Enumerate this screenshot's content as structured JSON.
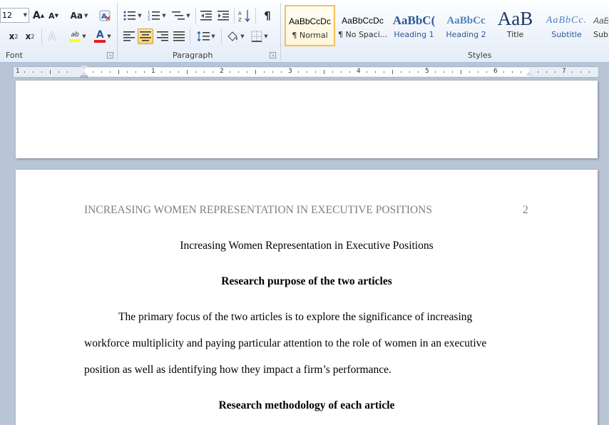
{
  "ribbon": {
    "font_group": {
      "label": "Font",
      "font_size": "12",
      "grow_label": "A",
      "shrink_label": "A",
      "case_label": "Aa",
      "clear_label": "A",
      "subscript_label": "x",
      "superscript_label": "x",
      "text_effects_label": "A",
      "highlight_label": "ab",
      "font_color_label": "A"
    },
    "paragraph_group": {
      "label": "Paragraph",
      "pilcrow": "¶"
    },
    "styles_group": {
      "label": "Styles",
      "tiles": [
        {
          "sample": "AaBbCcDc",
          "name": "¶ Normal"
        },
        {
          "sample": "AaBbCcDc",
          "name": "¶ No Spaci..."
        },
        {
          "sample": "AaBbC(",
          "name": "Heading 1"
        },
        {
          "sample": "AaBbCc",
          "name": "Heading 2"
        },
        {
          "sample": "AaB",
          "name": "Title"
        },
        {
          "sample": "AaBbCc.",
          "name": "Subtitle"
        },
        {
          "sample": "AaBbCcDc",
          "name": "Sub"
        }
      ]
    },
    "colors": {
      "highlight": "#ffff00",
      "font_color": "#e02020",
      "heading_blue": "#2b579a"
    }
  },
  "ruler": {
    "numbers": [
      "1",
      "1",
      "2",
      "3",
      "4",
      "5",
      "6",
      "7"
    ]
  },
  "document": {
    "header_text": "INCREASING WOMEN REPRESENTATION IN EXECUTIVE POSITIONS",
    "page_number": "2",
    "title": "Increasing Women Representation in Executive Positions",
    "heading1": "Research purpose of the two articles",
    "para_lines": [
      "The primary focus of the two articles is to explore the significance of increasing",
      "workforce multiplicity and paying particular attention to the role of women in an executive",
      "position as well as identifying how they impact a firm’s performance."
    ],
    "heading2": "Research methodology of each article"
  }
}
